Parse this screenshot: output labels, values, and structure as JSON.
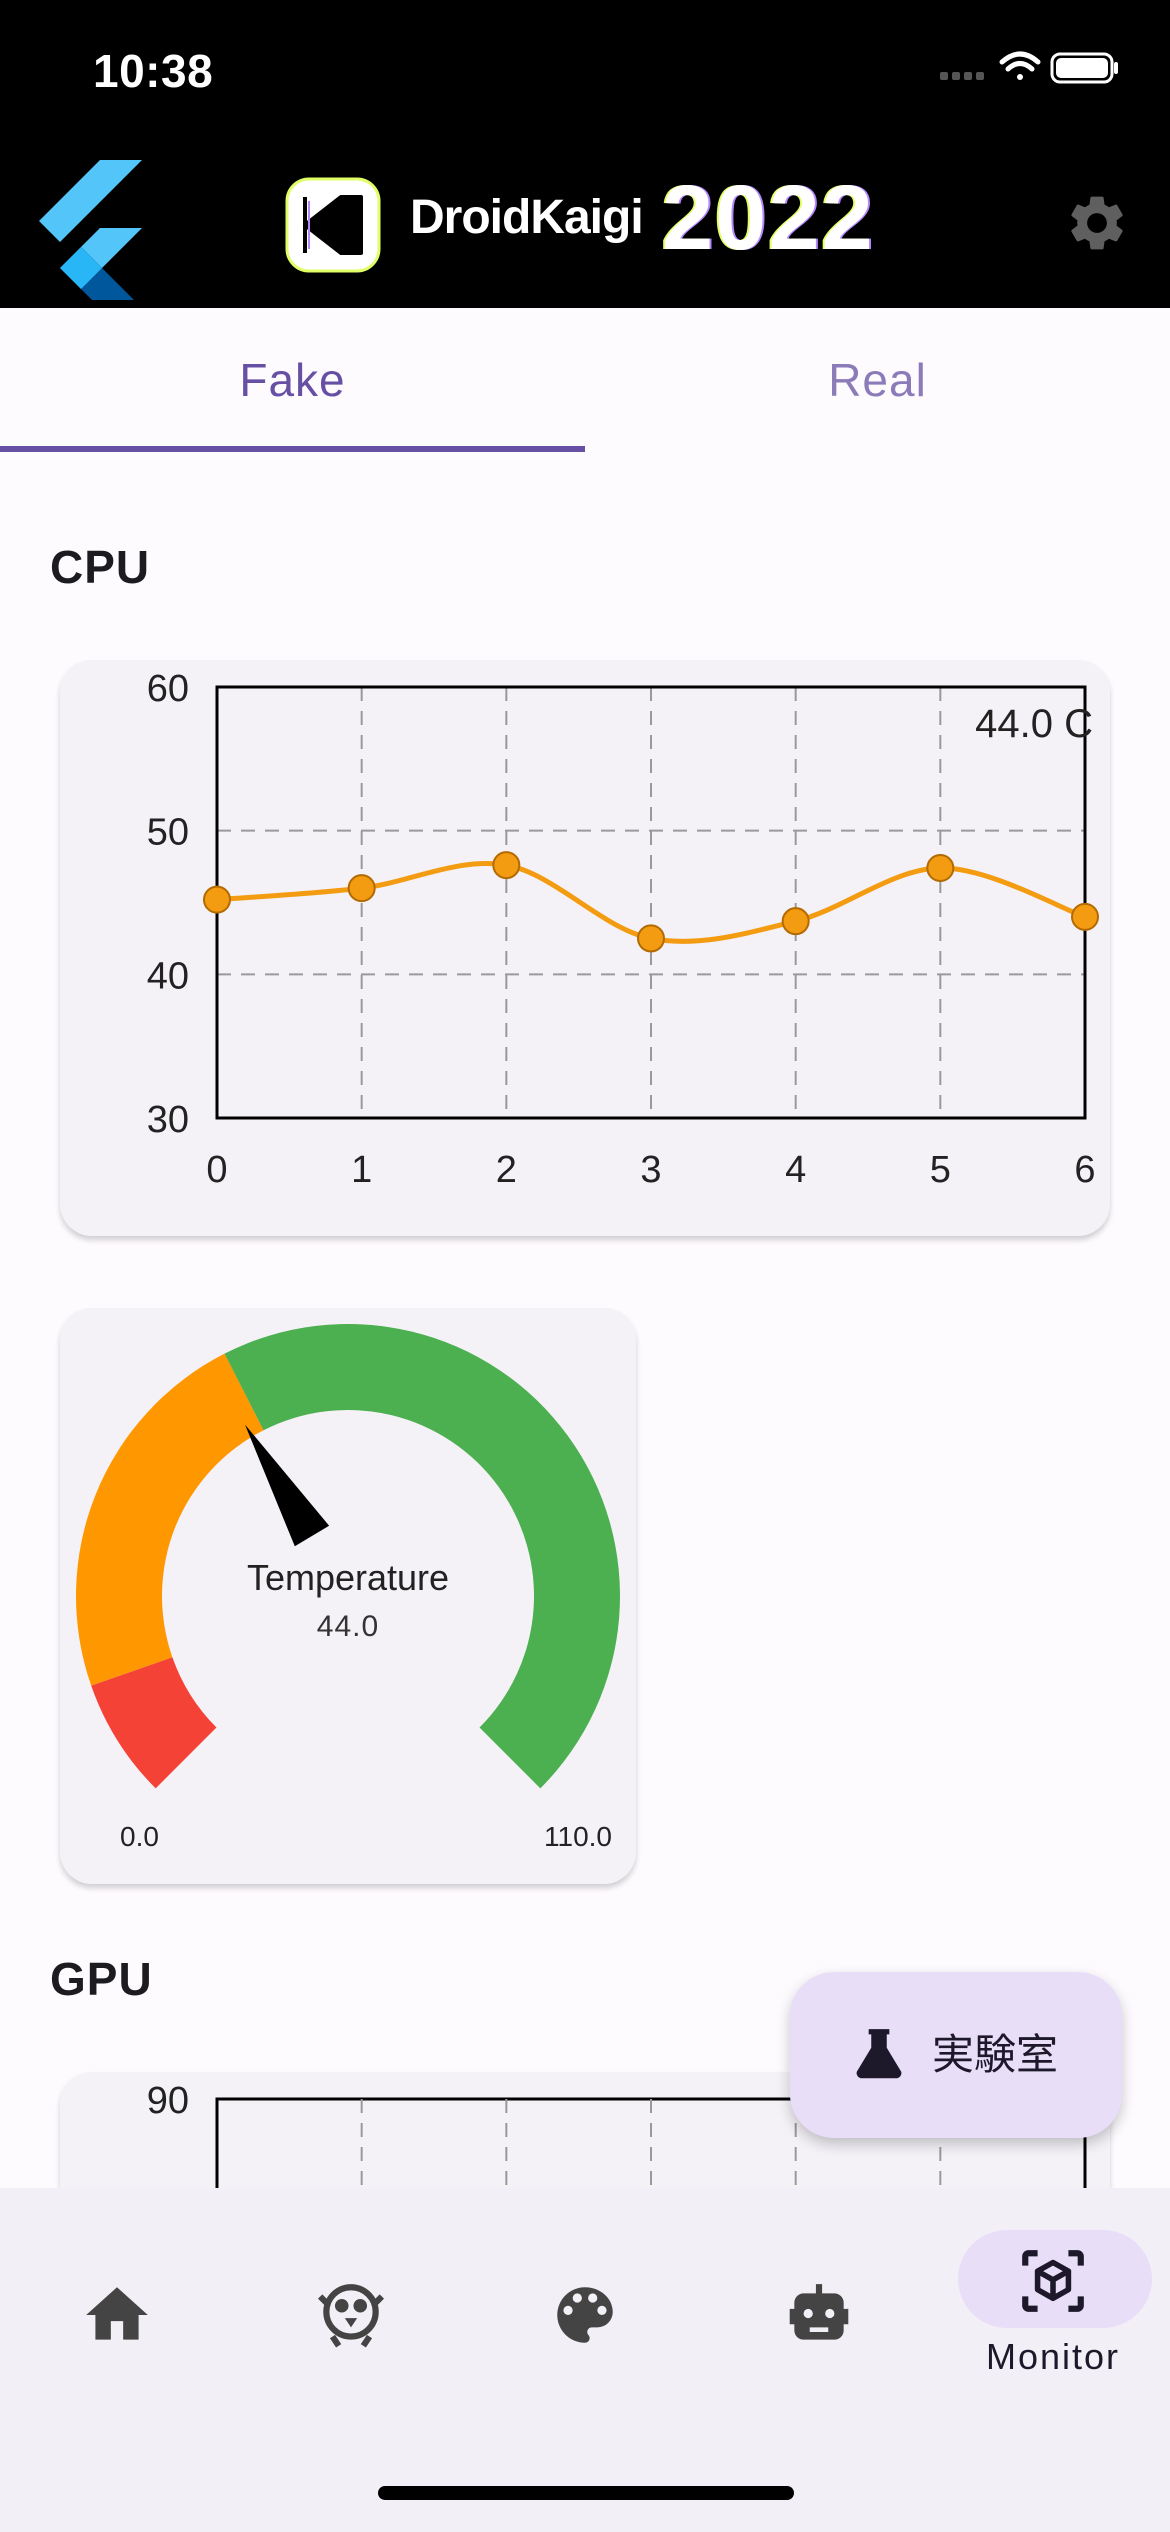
{
  "status_bar": {
    "time": "10:38"
  },
  "app_bar": {
    "brand": "DroidKaigi",
    "year": "2022"
  },
  "tabs": [
    {
      "label": "Fake",
      "selected": true
    },
    {
      "label": "Real",
      "selected": false
    }
  ],
  "cpu": {
    "title": "CPU",
    "current_label": "44.0 C",
    "gauge": {
      "title": "Temperature",
      "value_text": "44.0",
      "min_text": "0.0",
      "max_text": "110.0",
      "value": 44.0,
      "min": 0,
      "max": 110
    }
  },
  "gpu": {
    "title": "GPU"
  },
  "chart_data": [
    {
      "type": "line",
      "x": [
        0,
        1,
        2,
        3,
        4,
        5,
        6
      ],
      "values": [
        45.2,
        46.0,
        47.6,
        42.5,
        43.7,
        47.4,
        44.0
      ],
      "ylim": [
        30,
        60
      ],
      "xlim": [
        0,
        6
      ],
      "yticks": [
        30,
        40,
        50,
        60
      ],
      "xticks": [
        0,
        1,
        2,
        3,
        4,
        5,
        6
      ],
      "grid": true,
      "color": "#f39c12",
      "annotation": "44.0 C"
    },
    {
      "type": "line",
      "partial": true,
      "yticks_visible": [
        90
      ]
    }
  ],
  "fab": {
    "label": "実験室",
    "icon": "flask-icon"
  },
  "bottom_nav": {
    "items": [
      {
        "icon": "home-icon"
      },
      {
        "icon": "bird-icon"
      },
      {
        "icon": "palette-icon"
      },
      {
        "icon": "robot-icon"
      },
      {
        "icon": "monitor-cube-icon",
        "label": "Monitor",
        "selected": true
      }
    ]
  },
  "colors": {
    "accent": "#6750a4",
    "gauge_red": "#f44336",
    "gauge_orange": "#ff9800",
    "gauge_green": "#4caf50"
  }
}
